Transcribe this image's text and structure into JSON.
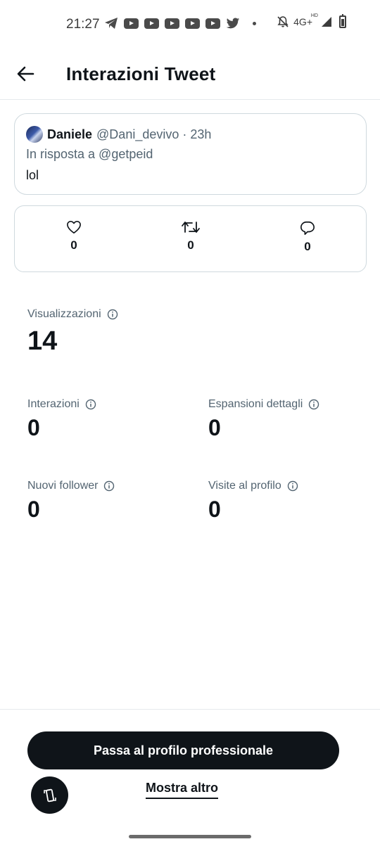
{
  "status_bar": {
    "time": "21:27",
    "network": "4G+",
    "network_sup": "HD",
    "icons": [
      "telegram-icon",
      "youtube-icon",
      "youtube-icon",
      "youtube-icon",
      "youtube-icon",
      "youtube-icon",
      "twitter-icon",
      "notifications-off-icon",
      "signal-icon",
      "battery-icon"
    ]
  },
  "header": {
    "title": "Interazioni Tweet",
    "back_icon": "arrow-left-icon"
  },
  "tweet": {
    "author_name": "Daniele",
    "author_handle": "@Dani_devivo · 23h",
    "reply_to": "In risposta a @getpeid",
    "text": "lol"
  },
  "engagement": {
    "likes": "0",
    "retweets": "0",
    "replies": "0"
  },
  "metrics": {
    "views_label": "Visualizzazioni",
    "views_value": "14",
    "interactions_label": "Interazioni",
    "interactions_value": "0",
    "detail_expansions_label": "Espansioni dettagli",
    "detail_expansions_value": "0",
    "new_followers_label": "Nuovi follower",
    "new_followers_value": "0",
    "profile_visits_label": "Visite al profilo",
    "profile_visits_value": "0"
  },
  "actions": {
    "pro_button_label": "Passa al profilo professionale",
    "more_link_label": "Mostra altro"
  },
  "colors": {
    "text_primary": "#0f1419",
    "text_secondary": "#536471",
    "border": "#cfd9de",
    "button_bg": "#0f1419"
  }
}
